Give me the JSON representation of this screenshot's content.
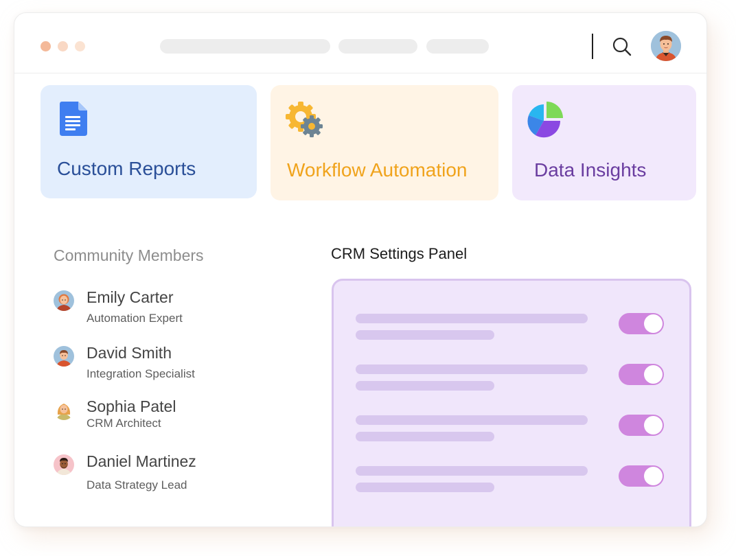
{
  "window": {
    "dot_colors": [
      "#f4b999",
      "#f9d8c4",
      "#fbe3d2"
    ],
    "header_icons": [
      "search-icon",
      "user-avatar"
    ]
  },
  "cards": [
    {
      "title": "Custom Reports",
      "icon": "document-icon",
      "color": "#2a4f98",
      "bg": "#e3eefd"
    },
    {
      "title": "Workflow Automation",
      "icon": "gears-icon",
      "color": "#f0a31c",
      "bg": "#fff4e5"
    },
    {
      "title": "Data Insights",
      "icon": "pie-chart-icon",
      "color": "#6a3da0",
      "bg": "#f2e9fc"
    }
  ],
  "members": {
    "heading": "Community Members",
    "items": [
      {
        "name": "Emily Carter",
        "role": "Automation Expert",
        "avatar_bg": "#9fc1dc"
      },
      {
        "name": "David Smith",
        "role": "Integration Specialist",
        "avatar_bg": "#9fc1dc"
      },
      {
        "name": "Sophia Patel",
        "role": "CRM Architect",
        "avatar_bg": "#ffffff"
      },
      {
        "name": "Daniel Martinez",
        "role": "Data Strategy Lead",
        "avatar_bg": "#f6c3c9"
      }
    ]
  },
  "settings_panel": {
    "heading": "CRM Settings Panel",
    "toggles": [
      {
        "state": "on"
      },
      {
        "state": "on"
      },
      {
        "state": "on"
      },
      {
        "state": "on"
      }
    ],
    "accent": "#cf86de"
  }
}
